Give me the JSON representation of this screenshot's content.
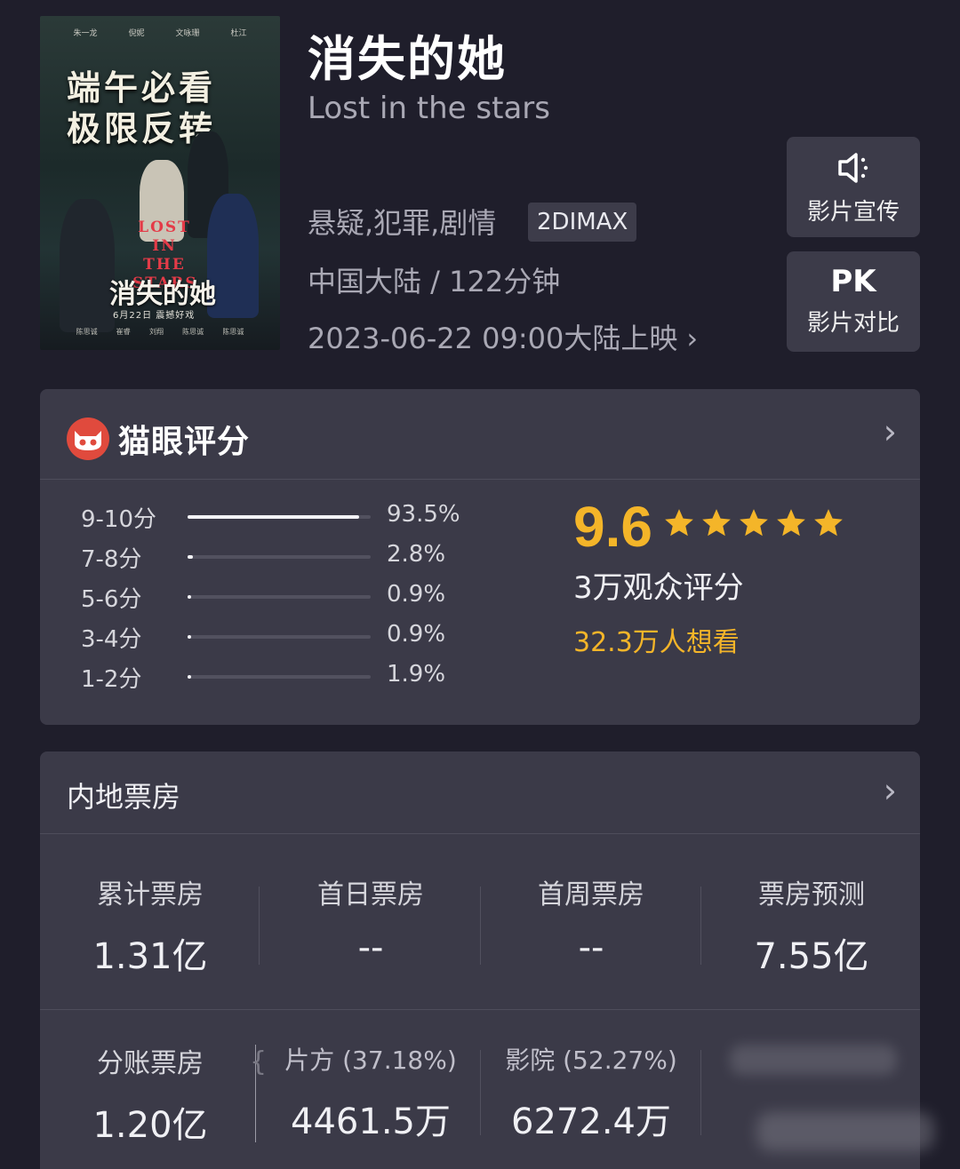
{
  "movie": {
    "title": "消失的她",
    "subtitle": "Lost in the stars",
    "genres": "悬疑,犯罪,剧情",
    "format_tag": "2DIMAX",
    "region_duration": "中国大陆 / 122分钟",
    "release": "2023-06-22 09:00大陆上映",
    "release_chevron": "›"
  },
  "poster": {
    "credits": [
      "朱一龙",
      "倪妮",
      "文咏珊",
      "杜江"
    ],
    "tagline_line1": "端午必看",
    "tagline_line2": "极限反转",
    "en_title": "LOST IN THE STARS",
    "cn_title": "消失的她",
    "date": "6月22日 震撼好戏",
    "names": [
      "陈思诚",
      "崔睿",
      "刘翔",
      "陈思诚",
      "陈思诚"
    ]
  },
  "side_buttons": {
    "promo_label": "影片宣传",
    "pk_text": "PK",
    "pk_label": "影片对比"
  },
  "rating": {
    "brand": "猫眼评分",
    "chevron": "›",
    "distribution": [
      {
        "label": "9-10分",
        "pct": "93.5%",
        "fraction": 0.935
      },
      {
        "label": "7-8分",
        "pct": "2.8%",
        "fraction": 0.028
      },
      {
        "label": "5-6分",
        "pct": "0.9%",
        "fraction": 0.009
      },
      {
        "label": "3-4分",
        "pct": "0.9%",
        "fraction": 0.009
      },
      {
        "label": "1-2分",
        "pct": "1.9%",
        "fraction": 0.019
      }
    ],
    "score": "9.6",
    "stars": 5,
    "audience": "3万观众评分",
    "want": "32.3万人想看",
    "accent_color": "#f4b529"
  },
  "box_office": {
    "title": "内地票房",
    "chevron": "›",
    "stats": [
      {
        "label": "累计票房",
        "value": "1.31亿"
      },
      {
        "label": "首日票房",
        "value": "--"
      },
      {
        "label": "首周票房",
        "value": "--"
      },
      {
        "label": "票房预测",
        "value": "7.55亿"
      }
    ],
    "split": {
      "label": "分账票房",
      "value": "1.20亿",
      "brace": "{",
      "producer_label": "片方 (37.18%)",
      "producer_value": "4461.5万",
      "cinema_label": "影院 (52.27%)",
      "cinema_value": "6272.4万"
    }
  }
}
